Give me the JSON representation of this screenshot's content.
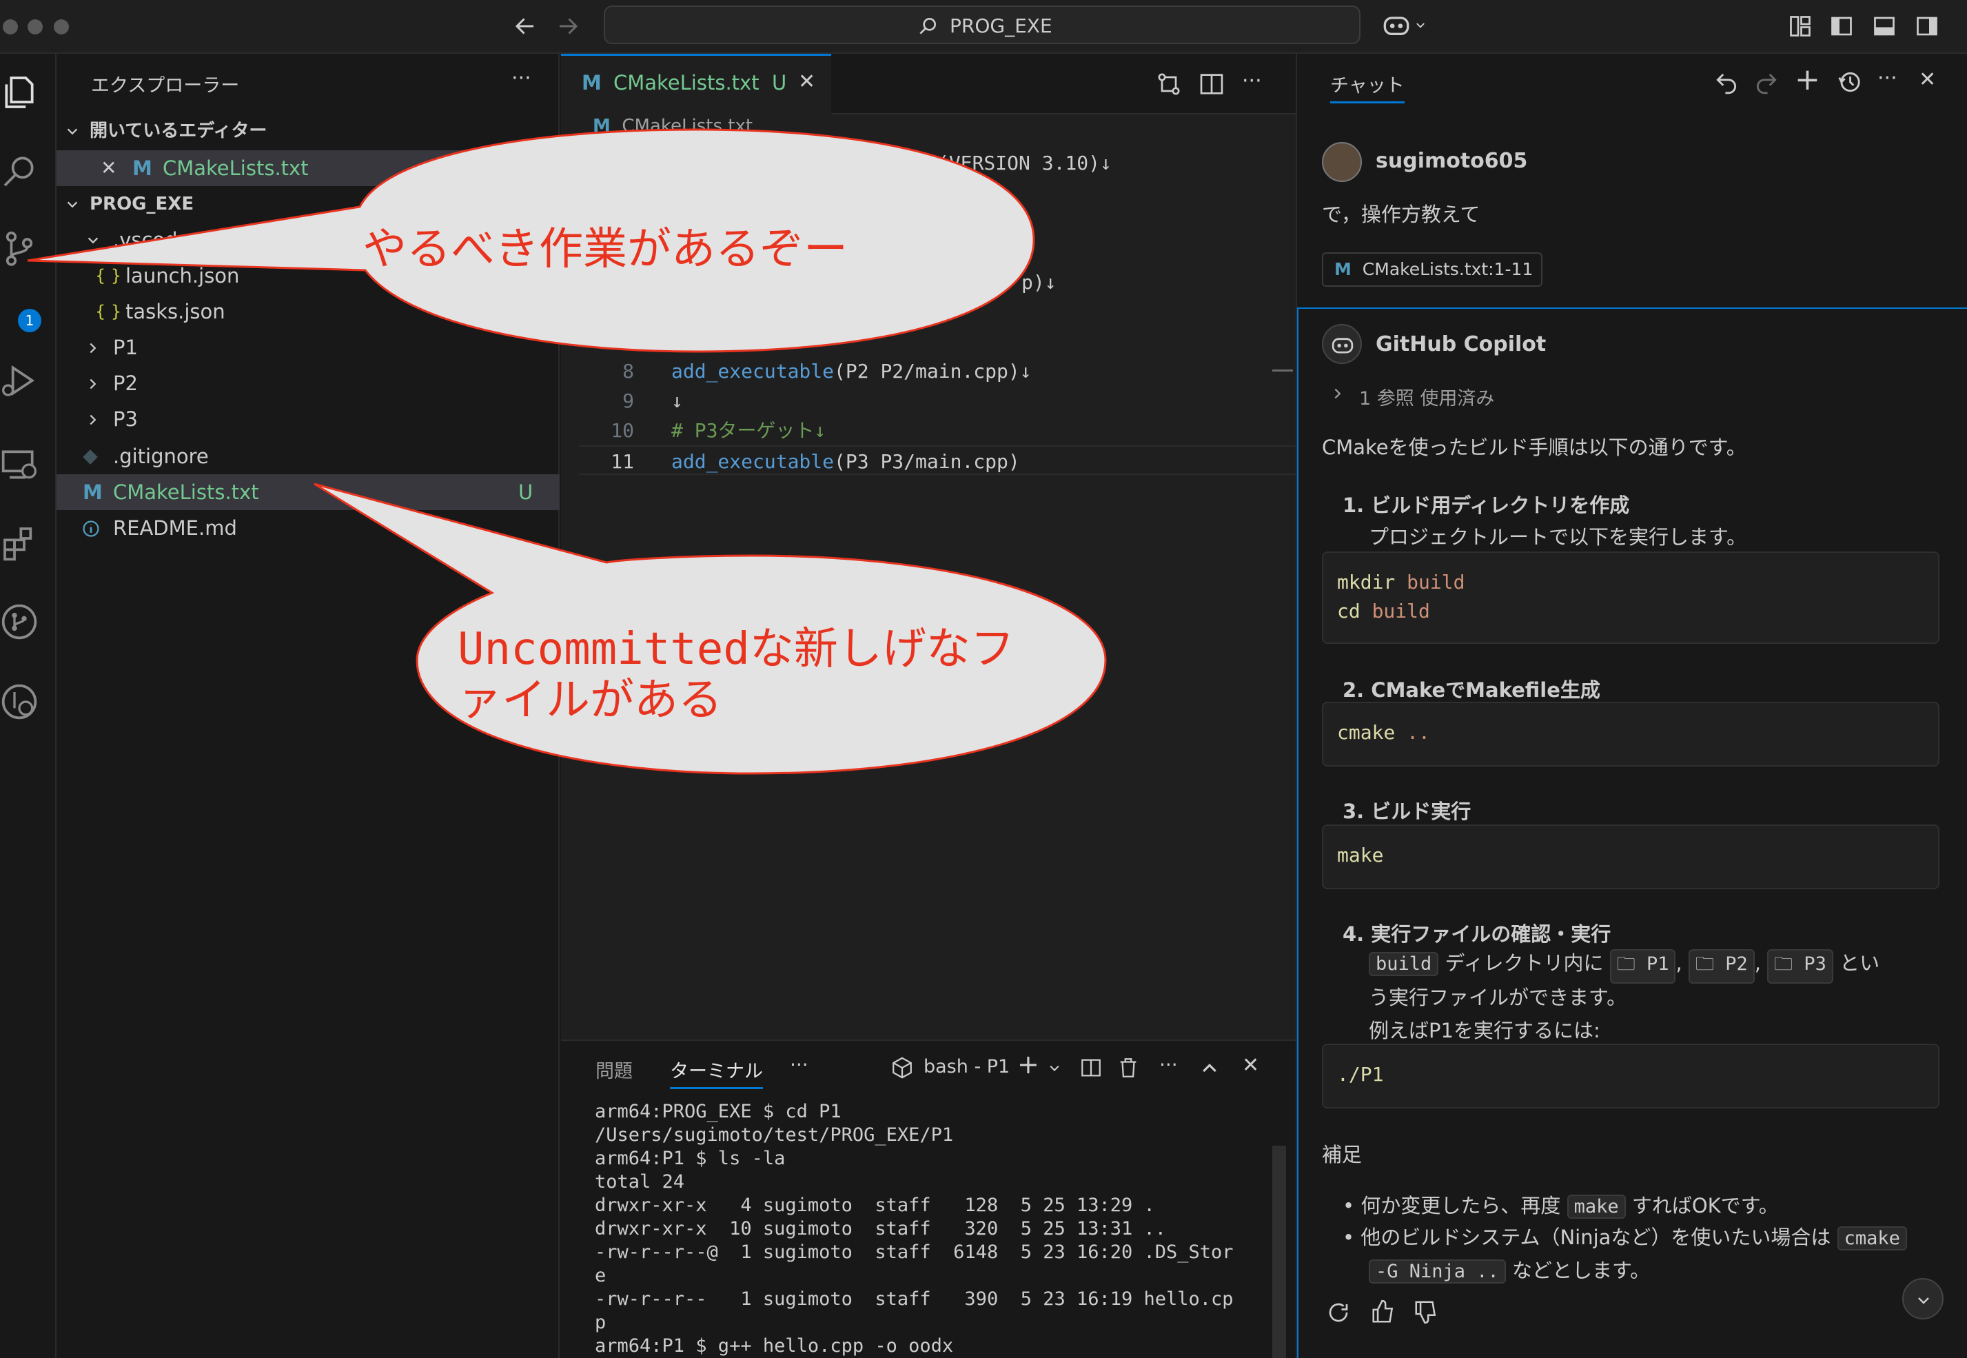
{
  "titlebar": {
    "search_text": "PROG_EXE",
    "icons": [
      "back-arrow-icon",
      "forward-arrow-icon",
      "search-icon",
      "copilot-icon",
      "layout-icon"
    ]
  },
  "explorer": {
    "title": "エクスプローラー",
    "open_editors_label": "開いているエディター",
    "open_editor_file": "CMakeLists.txt",
    "project_label": "PROG_EXE",
    "items": [
      {
        "label": ".vscode"
      },
      {
        "label": "launch.json"
      },
      {
        "label": "tasks.json"
      },
      {
        "label": "P1"
      },
      {
        "label": "P2"
      },
      {
        "label": "P3"
      },
      {
        "label": ".gitignore"
      },
      {
        "label": "CMakeLists.txt",
        "badge": "U"
      },
      {
        "label": "README.md"
      }
    ],
    "json_icon": "{ }",
    "m_icon": "M",
    "scm_badge": "1"
  },
  "editor": {
    "tab_label": "CMakeLists.txt",
    "tab_badge": "U",
    "breadcrumb": "CMakeLists.txt",
    "partial_line1": "(VERSION 3.10)↓",
    "partial_line2": "p)↓",
    "lines": [
      {
        "num": "8",
        "func": "add_executable",
        "args": "(P2 P2/main.cpp)↓"
      },
      {
        "num": "9",
        "text": "↓"
      },
      {
        "num": "10",
        "comment": "# P3ターゲット↓"
      },
      {
        "num": "11",
        "func": "add_executable",
        "args": "(P3 P3/main.cpp)"
      }
    ]
  },
  "panel": {
    "tab_problems": "問題",
    "tab_terminal": "ターミナル",
    "more": "···",
    "terminal_name": "bash - P1",
    "lines": [
      "arm64:PROG_EXE $ cd P1",
      "/Users/sugimoto/test/PROG_EXE/P1",
      "arm64:P1 $ ls -la",
      "total 24",
      "drwxr-xr-x   4 sugimoto  staff   128  5 25 13:29 .",
      "drwxr-xr-x  10 sugimoto  staff   320  5 25 13:31 ..",
      "-rw-r--r--@  1 sugimoto  staff  6148  5 23 16:20 .DS_Stor",
      "e",
      "-rw-r--r--   1 sugimoto  staff   390  5 23 16:19 hello.cp",
      "p",
      "arm64:P1 $ g++ hello.cpp -o oodx"
    ]
  },
  "chat": {
    "tab_label": "チャット",
    "user_name": "sugimoto605",
    "user_message": "で，操作方教えて",
    "context_chip": "CMakeLists.txt:1-11",
    "assistant_name": "GitHub Copilot",
    "references": "1 参照 使用済み",
    "intro": "CMakeを使ったビルド手順は以下の通りです。",
    "step1_title": "1. ビルド用ディレクトリを作成",
    "step1_desc": "プロジェクトルートで以下を実行します。",
    "code1_l1_cmd": "mkdir",
    "code1_l1_arg": " build",
    "code1_l2_cmd": "cd",
    "code1_l2_arg": " build",
    "step2_title": "2. CMakeでMakefile生成",
    "code2_cmd": "cmake",
    "code2_arg": " ..",
    "step3_title": "3. ビルド実行",
    "code3_cmd": "make",
    "step4_title": "4. 実行ファイルの確認・実行",
    "step4_chip_build": "build",
    "step4_text_a": "ディレクトリ内に",
    "step4_chip_p1": "P1",
    "step4_chip_p2": "P2",
    "step4_chip_p3": "P3",
    "step4_text_b": "とい",
    "step4_text_c": "う実行ファイルができます。",
    "step4_text_d": "例えばP1を実行するには:",
    "code4": "./P1",
    "supplement_title": "補足",
    "bullet1_a": "何か変更したら、再度",
    "bullet1_chip": "make",
    "bullet1_b": "すればOKです。",
    "bullet2_a": "他のビルドシステム（Ninjaなど）を使いたい場合は",
    "bullet2_chip_a": "cmake",
    "bullet2_chip_b": "-G Ninja ..",
    "bullet2_b": "などとします。"
  },
  "annotations": {
    "bubble1": "やるべき作業があるぞー",
    "bubble2_line1": "Uncommittedな新しげなフ",
    "bubble2_line2": "ァイルがある"
  },
  "colors": {
    "accent": "#0078d4",
    "modified": "#73c991",
    "callout_red": "#e8331f",
    "callout_fill": "#e3e3e3"
  }
}
